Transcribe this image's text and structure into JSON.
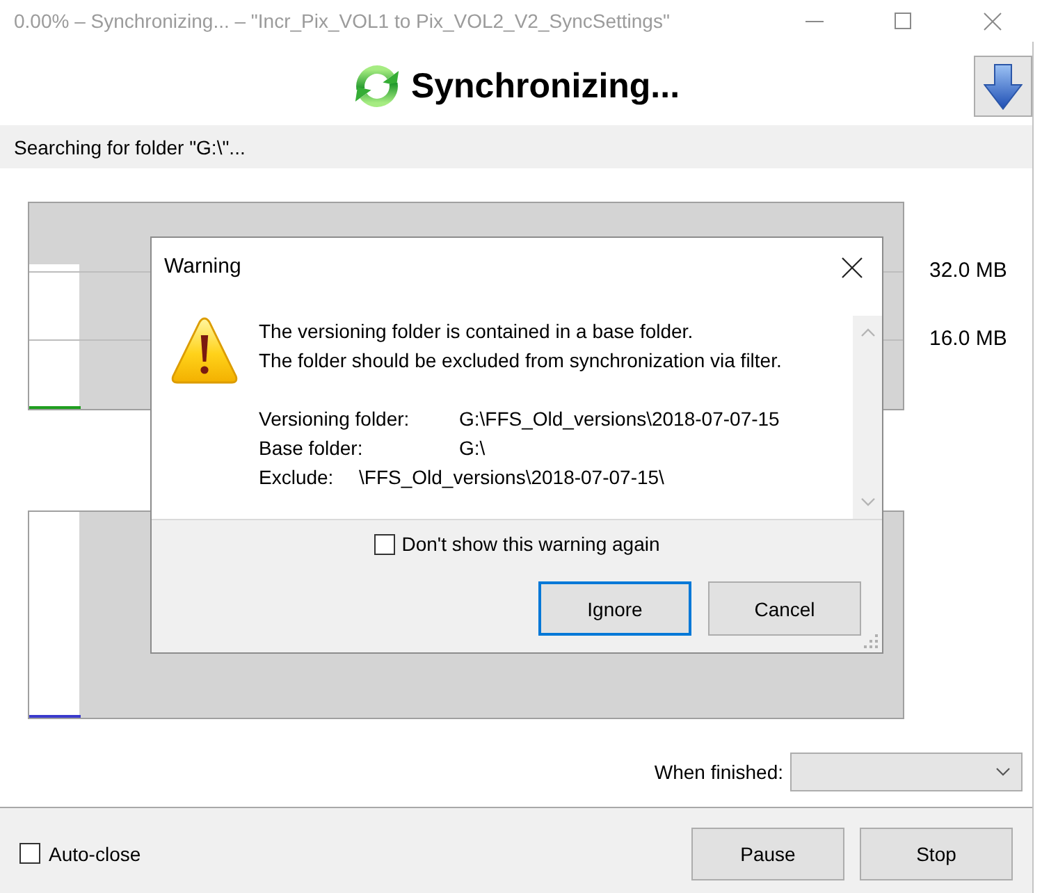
{
  "window": {
    "title": "0.00% – Synchronizing... – \"Incr_Pix_VOL1 to Pix_VOL2_V2_SyncSettings\""
  },
  "header": {
    "status": "Synchronizing..."
  },
  "status_bar": {
    "text": "Searching for folder \"G:\\\"..."
  },
  "graphs": [
    {
      "kind": "bytes",
      "axis_labels": [
        "32.0 MB",
        "16.0 MB"
      ]
    },
    {
      "kind": "items"
    }
  ],
  "dialog": {
    "title": "Warning",
    "message": [
      "The versioning folder is contained in a base folder.",
      "The folder should be excluded from synchronization via filter."
    ],
    "details": [
      {
        "label": "Versioning folder:",
        "value": "G:\\FFS_Old_versions\\2018-07-07-15"
      },
      {
        "label": "Base folder:",
        "value": "G:\\"
      },
      {
        "label": "Exclude:",
        "value": "\\FFS_Old_versions\\2018-07-07-15\\"
      }
    ],
    "checkbox": {
      "label": "Don't show this warning again",
      "checked": false
    },
    "buttons": [
      {
        "label": "Ignore",
        "default": true
      },
      {
        "label": "Cancel",
        "default": false
      }
    ]
  },
  "when_finished": {
    "label": "When finished:"
  },
  "auto_close": {
    "label": "Auto-close",
    "checked": false
  },
  "buttons": [
    {
      "label": "Pause"
    },
    {
      "label": "Stop"
    }
  ]
}
